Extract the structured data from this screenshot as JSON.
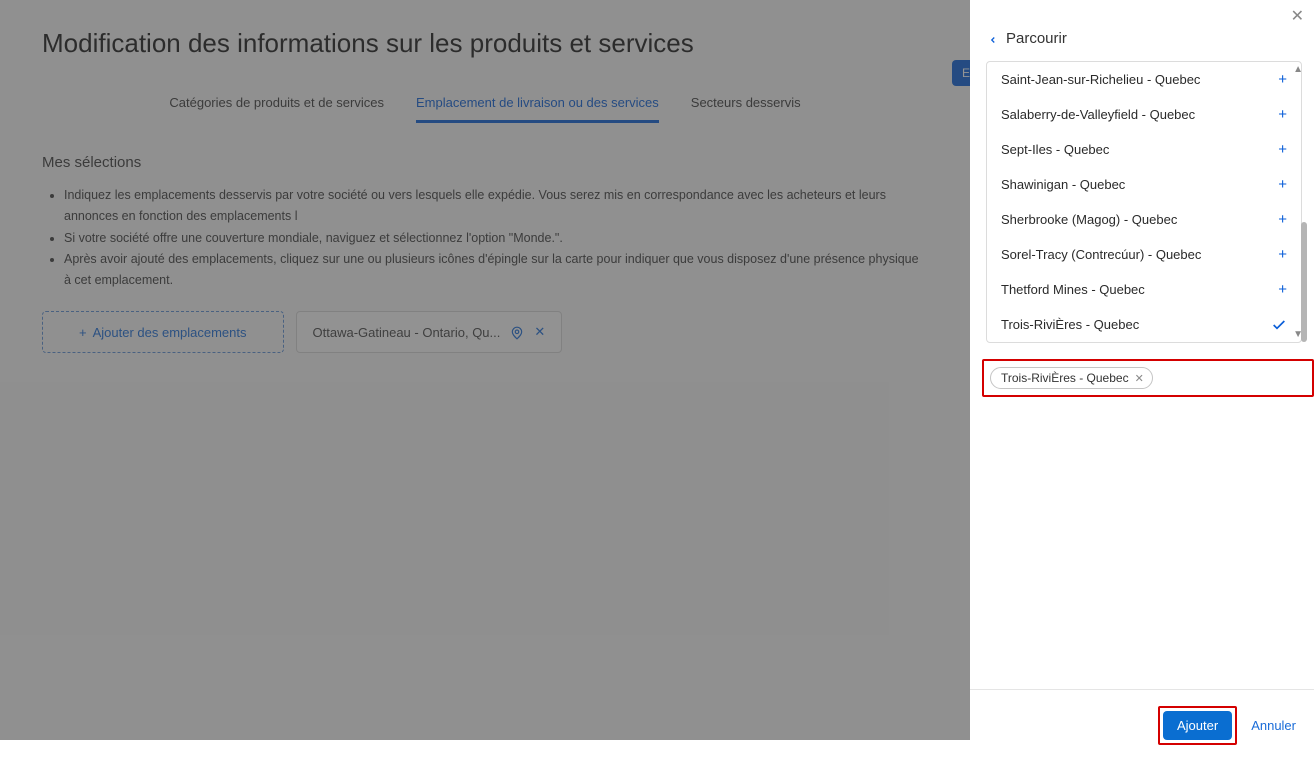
{
  "page": {
    "title": "Modification des informations sur les produits et services",
    "section_title": "Mes sélections",
    "tabs": [
      {
        "label": "Catégories de produits et de services",
        "active": false
      },
      {
        "label": "Emplacement de livraison ou des services",
        "active": true
      },
      {
        "label": "Secteurs desservis",
        "active": false
      }
    ],
    "hidden_button": "E",
    "bullets": [
      "Indiquez les emplacements desservis par votre société ou vers lesquels elle expédie. Vous serez mis en correspondance avec les acheteurs et leurs annonces en fonction des emplacements l",
      "Si votre société offre une couverture mondiale, naviguez et sélectionnez l'option \"Monde.\".",
      "Après avoir ajouté des emplacements, cliquez sur une ou plusieurs icônes d'épingle sur la carte pour indiquer que vous disposez d'une présence physique à cet emplacement."
    ],
    "add_locations_label": "Ajouter des emplacements",
    "existing_chip": "Ottawa-Gatineau - Ontario, Qu..."
  },
  "panel": {
    "title": "Parcourir",
    "locations": [
      {
        "label": "Saint-Jean-sur-Richelieu - Quebec",
        "selected": false
      },
      {
        "label": "Salaberry-de-Valleyfield - Quebec",
        "selected": false
      },
      {
        "label": "Sept-Iles - Quebec",
        "selected": false
      },
      {
        "label": "Shawinigan - Quebec",
        "selected": false
      },
      {
        "label": "Sherbrooke (Magog) - Quebec",
        "selected": false
      },
      {
        "label": "Sorel-Tracy (Contrecúur) - Quebec",
        "selected": false
      },
      {
        "label": "Thetford Mines - Quebec",
        "selected": false
      },
      {
        "label": "Trois-RiviÈres - Quebec",
        "selected": true
      }
    ],
    "selected_chip": "Trois-RiviÈres - Quebec",
    "add_button": "Ajouter",
    "cancel_button": "Annuler"
  }
}
